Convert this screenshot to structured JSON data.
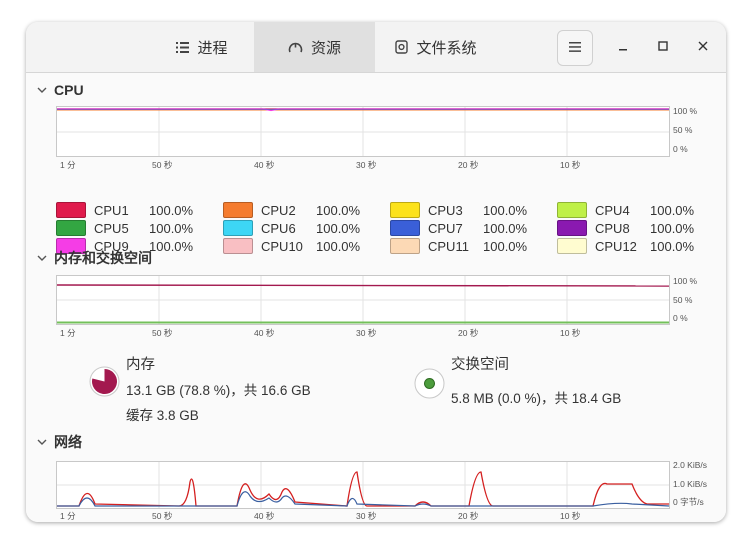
{
  "tabs": [
    {
      "label": "进程",
      "icon": "list-icon"
    },
    {
      "label": "资源",
      "icon": "gauge-icon"
    },
    {
      "label": "文件系统",
      "icon": "disk-icon"
    }
  ],
  "window_buttons": {
    "menu": "hamburger-menu-icon",
    "minimize": "minimize-icon",
    "maximize": "maximize-icon",
    "close": "close-icon"
  },
  "cpu": {
    "title": "CPU",
    "y_labels": [
      "100 %",
      "50 %",
      "0 %"
    ],
    "x_labels": [
      "1 分",
      "50 秒",
      "40 秒",
      "30 秒",
      "20 秒",
      "10 秒"
    ],
    "cores": [
      {
        "name": "CPU1",
        "value": "100.0%",
        "color": "#e01b4c"
      },
      {
        "name": "CPU2",
        "value": "100.0%",
        "color": "#f57c2f"
      },
      {
        "name": "CPU3",
        "value": "100.0%",
        "color": "#fce21b"
      },
      {
        "name": "CPU4",
        "value": "100.0%",
        "color": "#bff047"
      },
      {
        "name": "CPU5",
        "value": "100.0%",
        "color": "#33a642"
      },
      {
        "name": "CPU6",
        "value": "100.0%",
        "color": "#3dd6f5"
      },
      {
        "name": "CPU7",
        "value": "100.0%",
        "color": "#3a5fd8"
      },
      {
        "name": "CPU8",
        "value": "100.0%",
        "color": "#8a19b0"
      },
      {
        "name": "CPU9",
        "value": "100.0%",
        "color": "#f53de6"
      },
      {
        "name": "CPU10",
        "value": "100.0%",
        "color": "#f9bfc3"
      },
      {
        "name": "CPU11",
        "value": "100.0%",
        "color": "#fcd9b5"
      },
      {
        "name": "CPU12",
        "value": "100.0%",
        "color": "#fffcd0"
      }
    ]
  },
  "memory": {
    "title": "内存和交换空间",
    "y_labels": [
      "100 %",
      "50 %",
      "0 %"
    ],
    "x_labels": [
      "1 分",
      "50 秒",
      "40 秒",
      "30 秒",
      "20 秒",
      "10 秒"
    ],
    "ram": {
      "label": "内存",
      "usage": "13.1 GB (78.8 %)，共 16.6 GB",
      "cache": "缓存 3.8 GB",
      "fraction": 0.788,
      "color": "#a3194f"
    },
    "swap": {
      "label": "交换空间",
      "usage": "5.8 MB (0.0 %)，共 18.4 GB",
      "fraction": 0.0,
      "color": "#4c9c3c"
    }
  },
  "network": {
    "title": "网络",
    "y_labels": [
      "2.0 KiB/s",
      "1.0 KiB/s",
      "0 字节/s"
    ],
    "x_labels": [
      "1 分",
      "50 秒",
      "40 秒",
      "30 秒",
      "20 秒",
      "10 秒"
    ]
  }
}
